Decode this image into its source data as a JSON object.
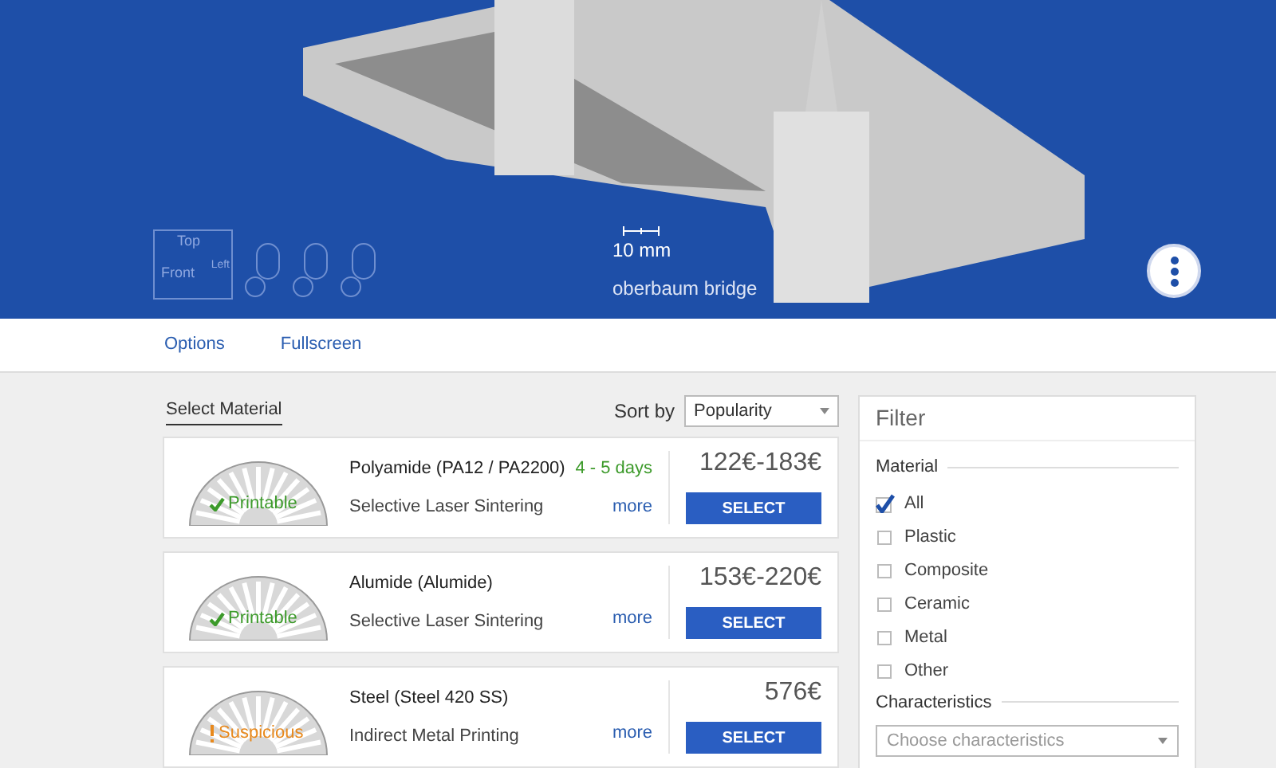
{
  "viewer": {
    "cube_faces": [
      "Top",
      "Front",
      "Left"
    ],
    "scale": "10 mm",
    "model_name": "oberbaum bridge"
  },
  "toolbar": {
    "links": [
      "Options",
      "Fullscreen"
    ]
  },
  "materials": {
    "heading": "Select Material",
    "sort_label": "Sort by",
    "sort_value": "Popularity",
    "items": [
      {
        "name": "Polyamide (PA12 / PA2200)",
        "process": "Selective Laser Sintering",
        "delivery": "4 - 5 days",
        "more": "more",
        "price": "122€-183€",
        "button": "SELECT",
        "badge": "Printable",
        "printable": true
      },
      {
        "name": "Alumide (Alumide)",
        "process": "Selective Laser Sintering",
        "more": "more",
        "price": "153€-220€",
        "button": "SELECT",
        "badge": "Printable",
        "printable": true
      },
      {
        "name": "Steel (Steel 420 SS)",
        "process": "Indirect Metal Printing",
        "more": "more",
        "price": "576€",
        "button": "SELECT",
        "badge": "Suspicious",
        "printable": false
      }
    ]
  },
  "filter": {
    "title": "Filter",
    "material_heading": "Material",
    "options": [
      {
        "label": "All",
        "checked": true
      },
      {
        "label": "Plastic",
        "checked": false
      },
      {
        "label": "Composite",
        "checked": false
      },
      {
        "label": "Ceramic",
        "checked": false
      },
      {
        "label": "Metal",
        "checked": false
      },
      {
        "label": "Other",
        "checked": false
      }
    ],
    "characteristics_heading": "Characteristics",
    "characteristics_placeholder": "Choose characteristics"
  }
}
